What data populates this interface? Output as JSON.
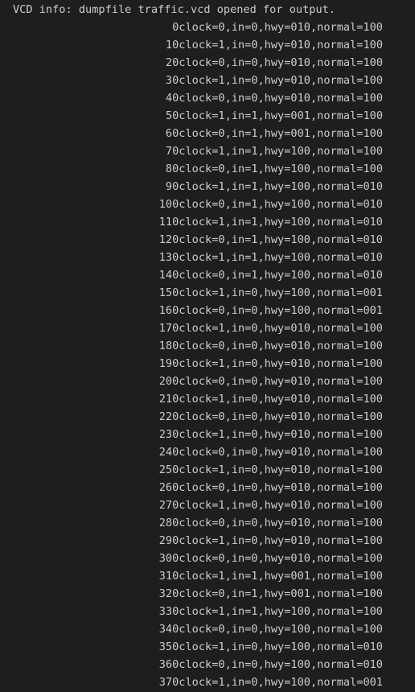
{
  "terminal": {
    "background": "#1e1e1e",
    "foreground": "#cccccc",
    "header": "VCD info: dumpfile traffic.vcd opened for output.",
    "lines": [
      "0clock=0,in=0,hwy=010,normal=100",
      "10clock=1,in=0,hwy=010,normal=100",
      "20clock=0,in=0,hwy=010,normal=100",
      "30clock=1,in=0,hwy=010,normal=100",
      "40clock=0,in=0,hwy=010,normal=100",
      "50clock=1,in=1,hwy=001,normal=100",
      "60clock=0,in=1,hwy=001,normal=100",
      "70clock=1,in=1,hwy=100,normal=100",
      "80clock=0,in=1,hwy=100,normal=100",
      "90clock=1,in=1,hwy=100,normal=010",
      "100clock=0,in=1,hwy=100,normal=010",
      "110clock=1,in=1,hwy=100,normal=010",
      "120clock=0,in=1,hwy=100,normal=010",
      "130clock=1,in=1,hwy=100,normal=010",
      "140clock=0,in=1,hwy=100,normal=010",
      "150clock=1,in=0,hwy=100,normal=001",
      "160clock=0,in=0,hwy=100,normal=001",
      "170clock=1,in=0,hwy=010,normal=100",
      "180clock=0,in=0,hwy=010,normal=100",
      "190clock=1,in=0,hwy=010,normal=100",
      "200clock=0,in=0,hwy=010,normal=100",
      "210clock=1,in=0,hwy=010,normal=100",
      "220clock=0,in=0,hwy=010,normal=100",
      "230clock=1,in=0,hwy=010,normal=100",
      "240clock=0,in=0,hwy=010,normal=100",
      "250clock=1,in=0,hwy=010,normal=100",
      "260clock=0,in=0,hwy=010,normal=100",
      "270clock=1,in=0,hwy=010,normal=100",
      "280clock=0,in=0,hwy=010,normal=100",
      "290clock=1,in=0,hwy=010,normal=100",
      "300clock=0,in=0,hwy=010,normal=100",
      "310clock=1,in=1,hwy=001,normal=100",
      "320clock=0,in=1,hwy=001,normal=100",
      "330clock=1,in=1,hwy=100,normal=100",
      "340clock=0,in=0,hwy=100,normal=100",
      "350clock=1,in=0,hwy=100,normal=010",
      "360clock=0,in=0,hwy=100,normal=010",
      "370clock=1,in=0,hwy=100,normal=001"
    ]
  }
}
